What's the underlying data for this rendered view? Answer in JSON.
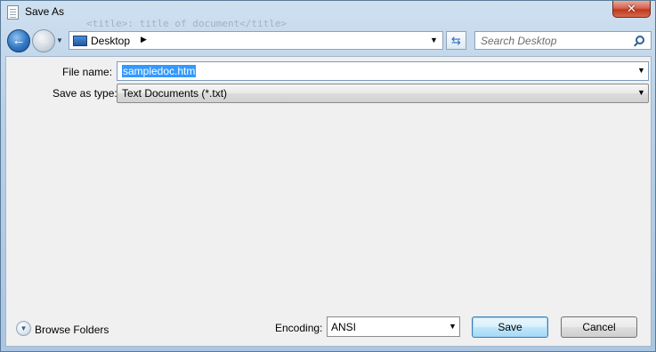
{
  "window": {
    "title": "Save As",
    "background_hint": "<title>: title of document</title>"
  },
  "navigation": {
    "back_icon": "back-arrow-icon",
    "forward_icon": "forward-arrow-icon",
    "location": "Desktop",
    "search_placeholder": "Search Desktop"
  },
  "form": {
    "file_name_label": "File name:",
    "file_name_value": "sampledoc.htm",
    "save_as_type_label": "Save as type:",
    "save_as_type_value": "Text Documents (*.txt)"
  },
  "footer": {
    "browse_folders_label": "Browse Folders",
    "encoding_label": "Encoding:",
    "encoding_value": "ANSI",
    "save_label": "Save",
    "cancel_label": "Cancel"
  },
  "colors": {
    "selection": "#3399ff",
    "close_button": "#c73a1f",
    "dialog_bg": "#f0f0f0"
  }
}
